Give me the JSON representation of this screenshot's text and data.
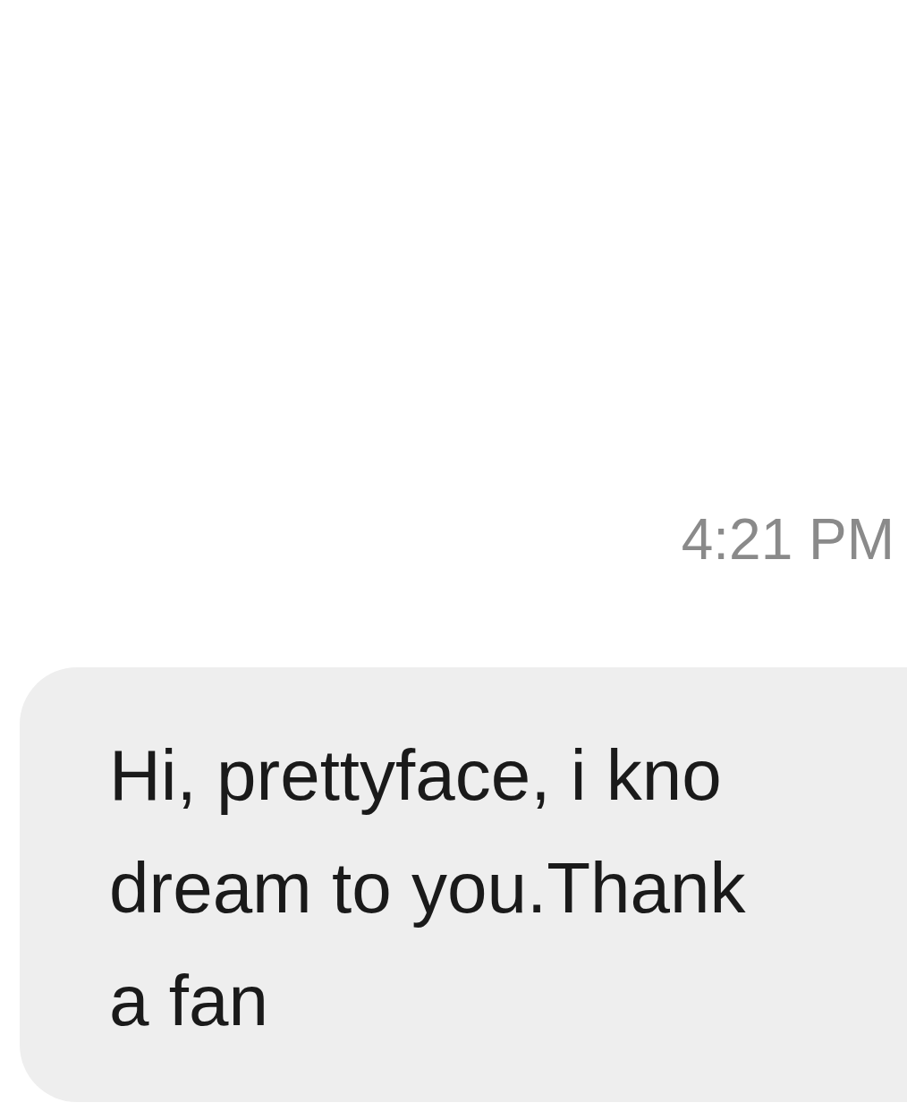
{
  "timestamp": "4:21 PM",
  "message": {
    "lines": [
      "Hi, prettyface, i kno",
      "dream to you.Thank",
      "a fan"
    ]
  }
}
